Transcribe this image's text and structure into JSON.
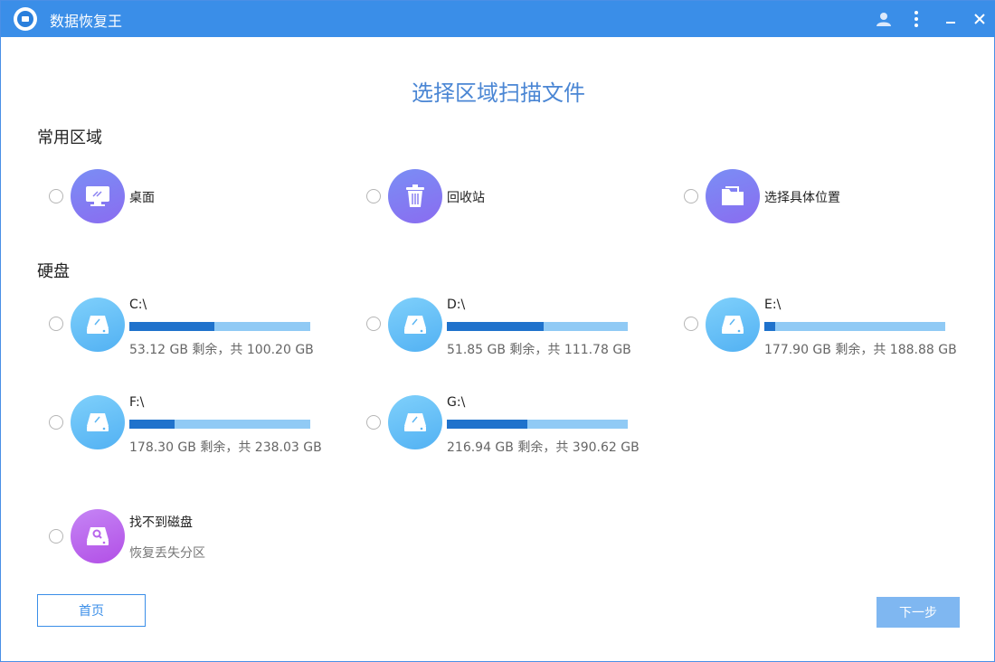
{
  "app": {
    "title": "数据恢复王"
  },
  "titlebar_icons": {
    "user": "user-icon",
    "more": "more-icon",
    "minimize": "minimize-icon",
    "close": "close-icon"
  },
  "page": {
    "heading": "选择区域扫描文件"
  },
  "common_area": {
    "title": "常用区域",
    "items": [
      {
        "label": "桌面",
        "icon": "desktop-icon"
      },
      {
        "label": "回收站",
        "icon": "recycle-bin-icon"
      },
      {
        "label": "选择具体位置",
        "icon": "folder-icon"
      }
    ]
  },
  "disks": {
    "title": "硬盘",
    "drives": [
      {
        "name": "C:\\",
        "info": "53.12 GB 剩余，共 100.20 GB",
        "used_fraction": 0.47
      },
      {
        "name": "D:\\",
        "info": "51.85 GB 剩余，共 111.78 GB",
        "used_fraction": 0.536
      },
      {
        "name": "E:\\",
        "info": "177.90 GB 剩余，共 188.88 GB",
        "used_fraction": 0.058
      },
      {
        "name": "F:\\",
        "info": "178.30 GB 剩余，共 238.03 GB",
        "used_fraction": 0.251
      },
      {
        "name": "G:\\",
        "info": "216.94 GB 剩余，共 390.62 GB",
        "used_fraction": 0.445
      }
    ]
  },
  "lost_disk": {
    "label": "找不到磁盘",
    "sub": "恢复丢失分区",
    "icon": "disk-search-icon"
  },
  "buttons": {
    "home": "首页",
    "next": "下一步"
  },
  "colors": {
    "titlebar": "#3a8ee8",
    "bar_fill": "#1f72cc",
    "bar_track": "#90caf5"
  }
}
